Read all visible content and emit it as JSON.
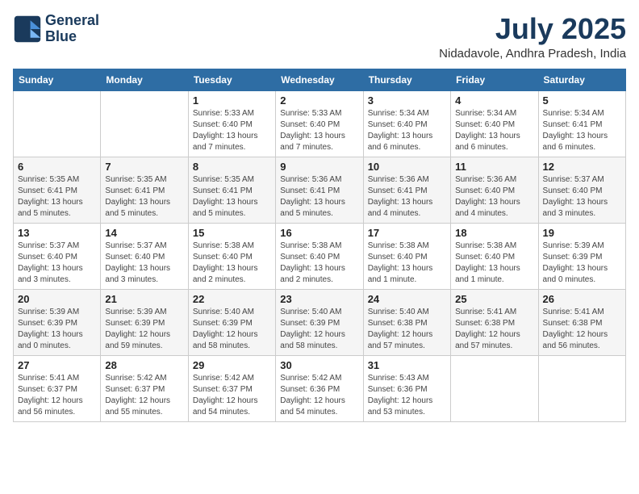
{
  "logo": {
    "line1": "General",
    "line2": "Blue"
  },
  "title": "July 2025",
  "location": "Nidadavole, Andhra Pradesh, India",
  "days_of_week": [
    "Sunday",
    "Monday",
    "Tuesday",
    "Wednesday",
    "Thursday",
    "Friday",
    "Saturday"
  ],
  "weeks": [
    [
      {
        "day": "",
        "info": ""
      },
      {
        "day": "",
        "info": ""
      },
      {
        "day": "1",
        "info": "Sunrise: 5:33 AM\nSunset: 6:40 PM\nDaylight: 13 hours and 7 minutes."
      },
      {
        "day": "2",
        "info": "Sunrise: 5:33 AM\nSunset: 6:40 PM\nDaylight: 13 hours and 7 minutes."
      },
      {
        "day": "3",
        "info": "Sunrise: 5:34 AM\nSunset: 6:40 PM\nDaylight: 13 hours and 6 minutes."
      },
      {
        "day": "4",
        "info": "Sunrise: 5:34 AM\nSunset: 6:40 PM\nDaylight: 13 hours and 6 minutes."
      },
      {
        "day": "5",
        "info": "Sunrise: 5:34 AM\nSunset: 6:41 PM\nDaylight: 13 hours and 6 minutes."
      }
    ],
    [
      {
        "day": "6",
        "info": "Sunrise: 5:35 AM\nSunset: 6:41 PM\nDaylight: 13 hours and 5 minutes."
      },
      {
        "day": "7",
        "info": "Sunrise: 5:35 AM\nSunset: 6:41 PM\nDaylight: 13 hours and 5 minutes."
      },
      {
        "day": "8",
        "info": "Sunrise: 5:35 AM\nSunset: 6:41 PM\nDaylight: 13 hours and 5 minutes."
      },
      {
        "day": "9",
        "info": "Sunrise: 5:36 AM\nSunset: 6:41 PM\nDaylight: 13 hours and 5 minutes."
      },
      {
        "day": "10",
        "info": "Sunrise: 5:36 AM\nSunset: 6:41 PM\nDaylight: 13 hours and 4 minutes."
      },
      {
        "day": "11",
        "info": "Sunrise: 5:36 AM\nSunset: 6:40 PM\nDaylight: 13 hours and 4 minutes."
      },
      {
        "day": "12",
        "info": "Sunrise: 5:37 AM\nSunset: 6:40 PM\nDaylight: 13 hours and 3 minutes."
      }
    ],
    [
      {
        "day": "13",
        "info": "Sunrise: 5:37 AM\nSunset: 6:40 PM\nDaylight: 13 hours and 3 minutes."
      },
      {
        "day": "14",
        "info": "Sunrise: 5:37 AM\nSunset: 6:40 PM\nDaylight: 13 hours and 3 minutes."
      },
      {
        "day": "15",
        "info": "Sunrise: 5:38 AM\nSunset: 6:40 PM\nDaylight: 13 hours and 2 minutes."
      },
      {
        "day": "16",
        "info": "Sunrise: 5:38 AM\nSunset: 6:40 PM\nDaylight: 13 hours and 2 minutes."
      },
      {
        "day": "17",
        "info": "Sunrise: 5:38 AM\nSunset: 6:40 PM\nDaylight: 13 hours and 1 minute."
      },
      {
        "day": "18",
        "info": "Sunrise: 5:38 AM\nSunset: 6:40 PM\nDaylight: 13 hours and 1 minute."
      },
      {
        "day": "19",
        "info": "Sunrise: 5:39 AM\nSunset: 6:39 PM\nDaylight: 13 hours and 0 minutes."
      }
    ],
    [
      {
        "day": "20",
        "info": "Sunrise: 5:39 AM\nSunset: 6:39 PM\nDaylight: 13 hours and 0 minutes."
      },
      {
        "day": "21",
        "info": "Sunrise: 5:39 AM\nSunset: 6:39 PM\nDaylight: 12 hours and 59 minutes."
      },
      {
        "day": "22",
        "info": "Sunrise: 5:40 AM\nSunset: 6:39 PM\nDaylight: 12 hours and 58 minutes."
      },
      {
        "day": "23",
        "info": "Sunrise: 5:40 AM\nSunset: 6:39 PM\nDaylight: 12 hours and 58 minutes."
      },
      {
        "day": "24",
        "info": "Sunrise: 5:40 AM\nSunset: 6:38 PM\nDaylight: 12 hours and 57 minutes."
      },
      {
        "day": "25",
        "info": "Sunrise: 5:41 AM\nSunset: 6:38 PM\nDaylight: 12 hours and 57 minutes."
      },
      {
        "day": "26",
        "info": "Sunrise: 5:41 AM\nSunset: 6:38 PM\nDaylight: 12 hours and 56 minutes."
      }
    ],
    [
      {
        "day": "27",
        "info": "Sunrise: 5:41 AM\nSunset: 6:37 PM\nDaylight: 12 hours and 56 minutes."
      },
      {
        "day": "28",
        "info": "Sunrise: 5:42 AM\nSunset: 6:37 PM\nDaylight: 12 hours and 55 minutes."
      },
      {
        "day": "29",
        "info": "Sunrise: 5:42 AM\nSunset: 6:37 PM\nDaylight: 12 hours and 54 minutes."
      },
      {
        "day": "30",
        "info": "Sunrise: 5:42 AM\nSunset: 6:36 PM\nDaylight: 12 hours and 54 minutes."
      },
      {
        "day": "31",
        "info": "Sunrise: 5:43 AM\nSunset: 6:36 PM\nDaylight: 12 hours and 53 minutes."
      },
      {
        "day": "",
        "info": ""
      },
      {
        "day": "",
        "info": ""
      }
    ]
  ]
}
